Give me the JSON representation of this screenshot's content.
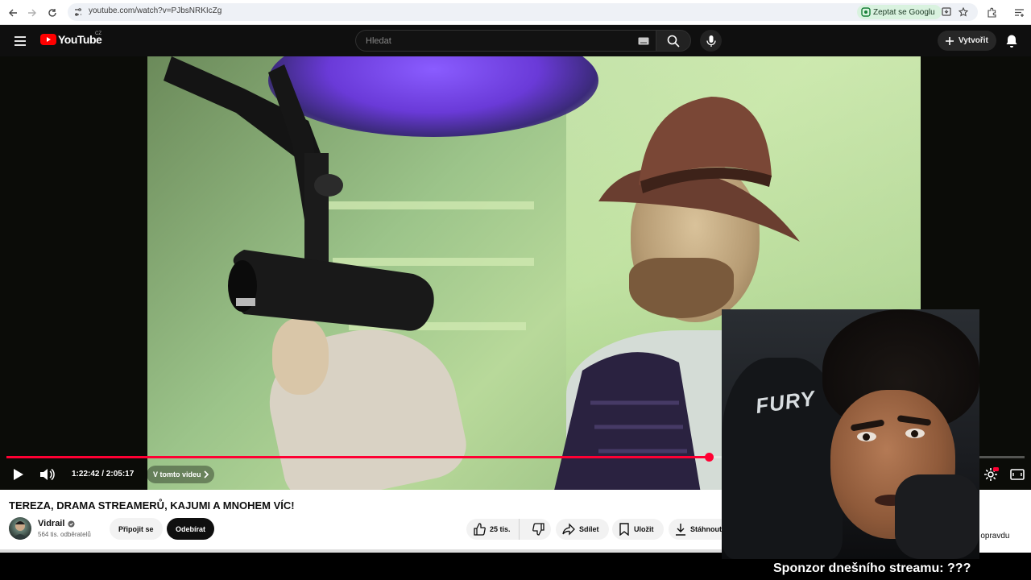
{
  "browser": {
    "url": "youtube.com/watch?v=PJbsNRKIcZg",
    "ask_google_label": "Zeptat se Googlu"
  },
  "header": {
    "logo_text": "YouTube",
    "country_code": "CZ",
    "search_placeholder": "Hledat",
    "create_label": "Vytvořit"
  },
  "player": {
    "current_time": "1:22:42",
    "duration": "2:05:17",
    "time_display": "1:22:42 / 2:05:17",
    "chapter_label": "V tomto videu",
    "progress_fraction": 0.69
  },
  "video": {
    "title": "TEREZA, DRAMA STREAMERŮ, KAJUMI A MNOHEM VÍC!",
    "channel_name": "Vidrail",
    "subscribers": "564 tis. odběratelů",
    "join_label": "Připojit se",
    "subscribe_label": "Odebírat",
    "likes": "25 tis.",
    "share_label": "Sdílet",
    "save_label": "Uložit",
    "download_label": "Stáhnout",
    "partial_text": "za opravdu"
  },
  "overlay": {
    "webcam_brand": "FURY",
    "sponsor_text": "Sponzor dnešního streamu: ???"
  },
  "colors": {
    "accent": "#ff0033",
    "youtube_red": "#ff0000",
    "dark_bg": "#0f0f0f"
  }
}
